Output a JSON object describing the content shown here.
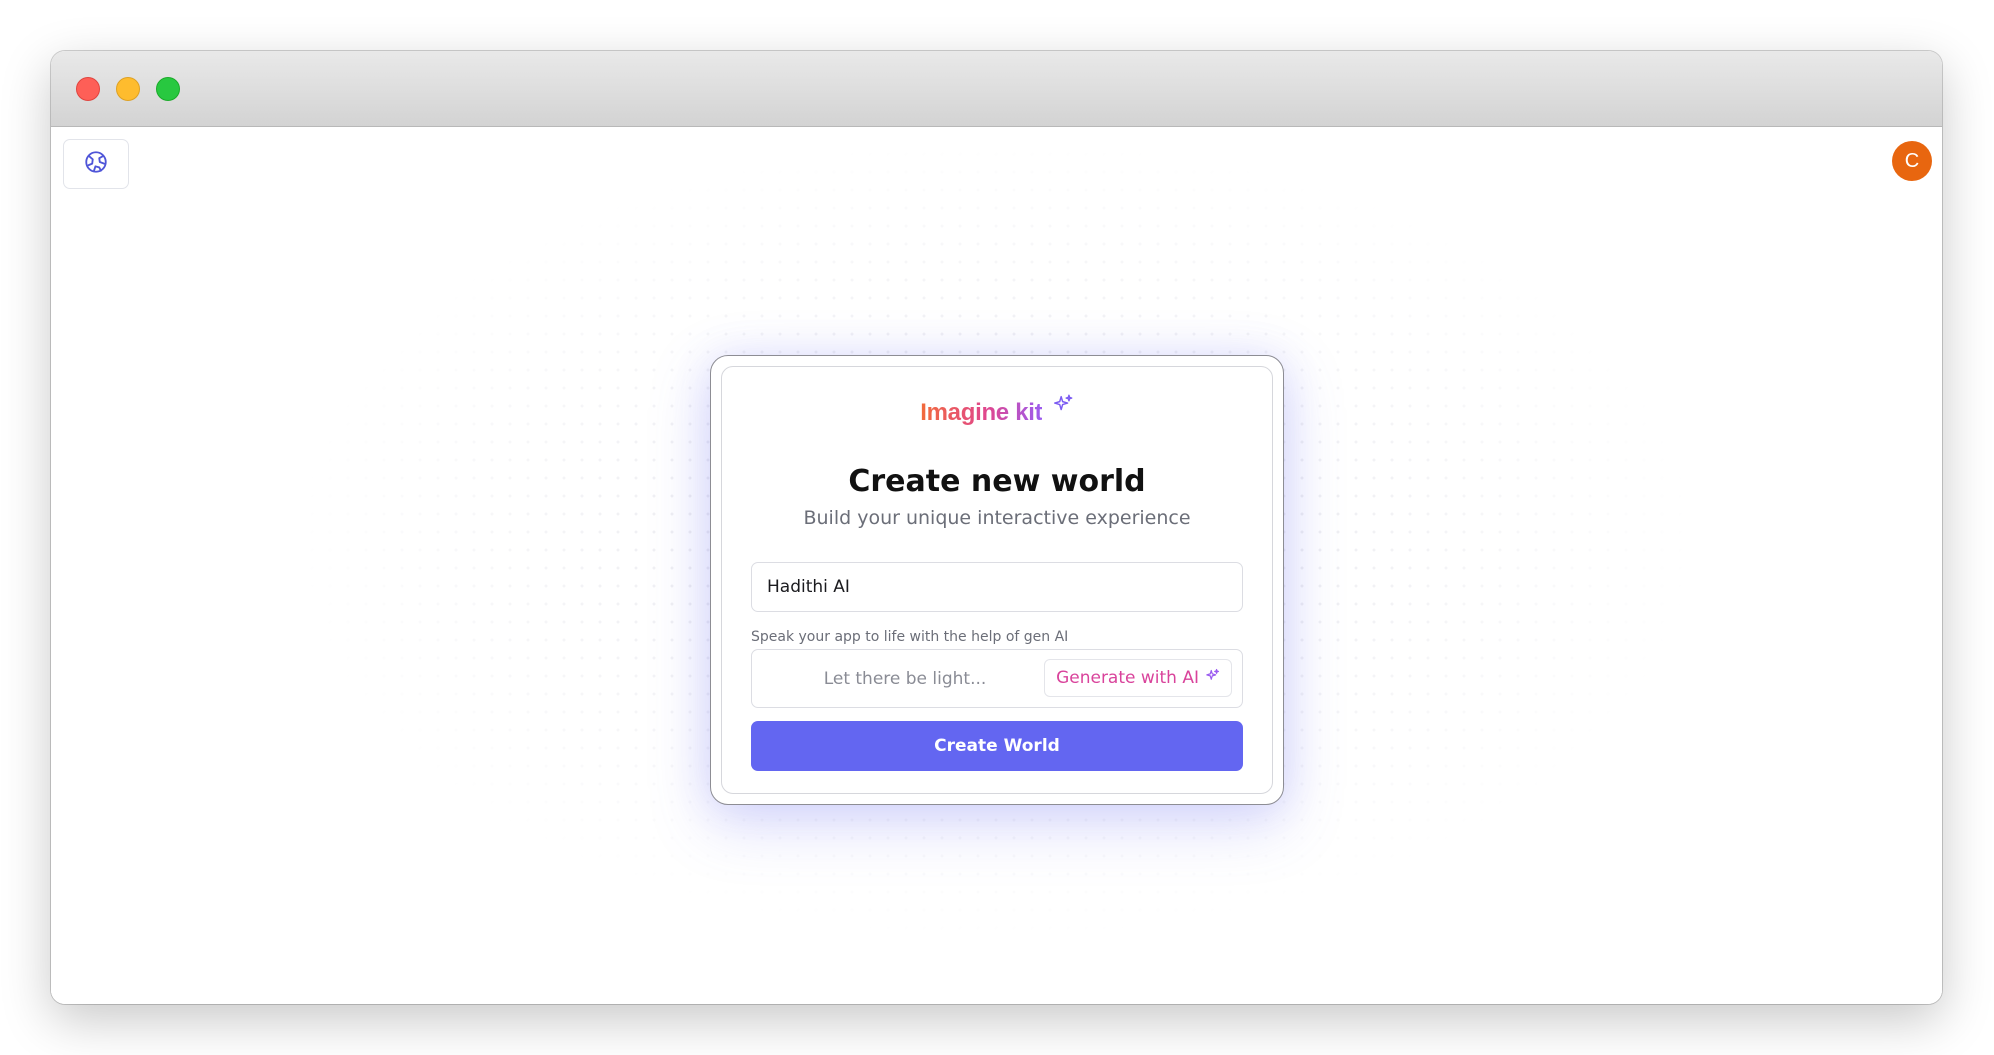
{
  "window": {
    "controls": [
      "close",
      "minimize",
      "maximize"
    ]
  },
  "toolbar": {
    "home_icon": "globe-icon"
  },
  "user": {
    "avatar_initial": "C",
    "avatar_color": "#e8660f"
  },
  "brand": {
    "name": "Imagine kit",
    "icon": "sparkle-icon",
    "gradient": [
      "#f26b3a",
      "#e0468f",
      "#9b5cf0"
    ]
  },
  "form": {
    "title": "Create new world",
    "subtitle": "Build your unique interactive experience",
    "name_value": "Hadithi AI",
    "helper_text": "Speak your app to life with the help of gen AI",
    "prompt_placeholder": "Let there be light...",
    "generate_label": "Generate with AI",
    "generate_icon": "sparkle-icon",
    "submit_label": "Create World"
  },
  "colors": {
    "accent": "#6366f1",
    "generate_text": "#d9439b"
  }
}
